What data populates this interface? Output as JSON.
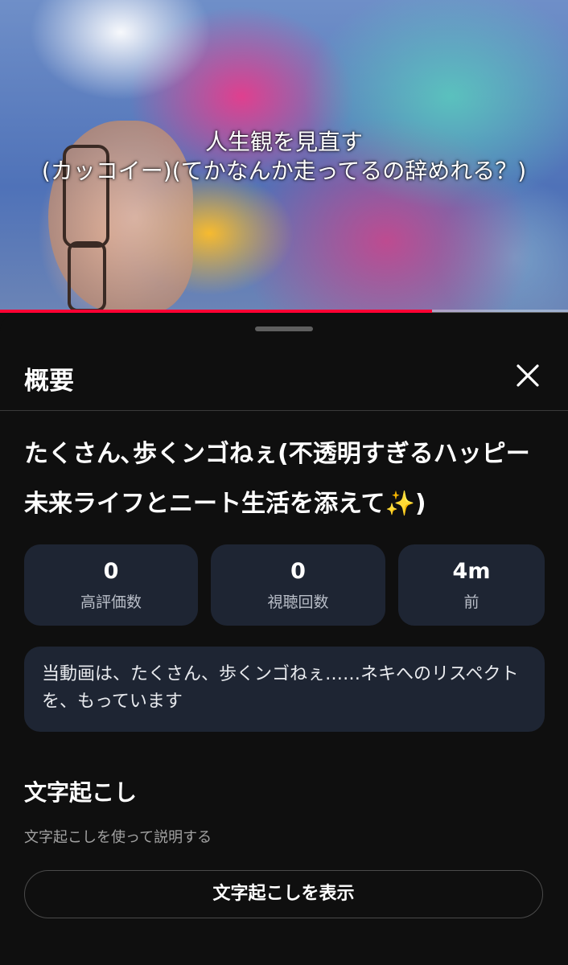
{
  "video": {
    "caption_line1": "人生観を見直す",
    "caption_line2": "(カッコイー)(てかなんか走ってるの辞めれる？)",
    "progress_percent": 76,
    "progress_color": "#ff0033"
  },
  "sheet": {
    "title": "概要",
    "close_icon": "close-icon",
    "video_title": "たくさん､歩くンゴねぇ(不透明すぎるハッピー未来ライフとニート生活を添えて✨)",
    "stats": [
      {
        "value": "0",
        "label": "高評価数"
      },
      {
        "value": "0",
        "label": "視聴回数"
      },
      {
        "value": "4m",
        "label": "前"
      }
    ],
    "description": "当動画は、たくさん、歩くンゴねぇ……ネキへのリスペクトを、もっています",
    "transcript": {
      "title": "文字起こし",
      "subtitle": "文字起こしを使って説明する",
      "button_label": "文字起こしを表示"
    }
  },
  "colors": {
    "background": "#0f0f0f",
    "card": "#1e2533",
    "accent": "#ff0033"
  }
}
